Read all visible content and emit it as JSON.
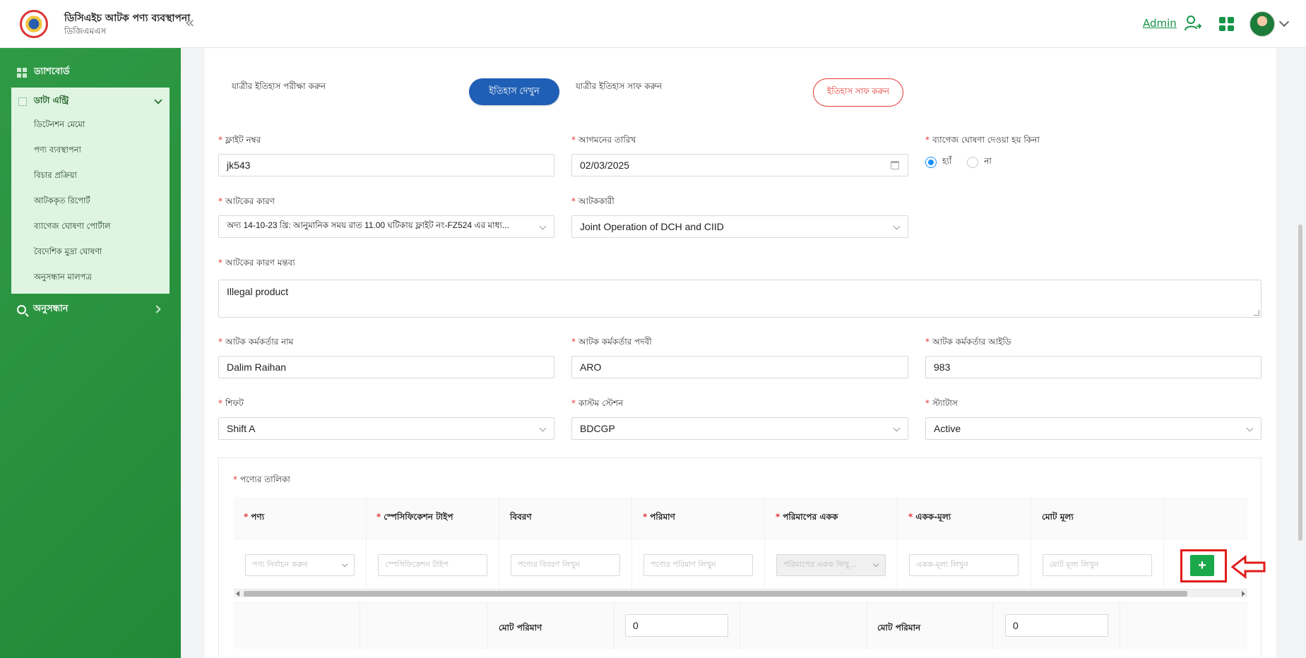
{
  "header": {
    "app_title": "ডিসিএইচ আটক পণ্য ব্যবস্থাপনা",
    "app_subtitle": "ডিজিএমএস",
    "user_label": "Admin"
  },
  "sidebar": {
    "dashboard": "ড্যাশবোর্ড",
    "data_entry": "ডাটা এন্ট্রি",
    "items": [
      "ডিটেনশন মেমো",
      "পণ্য ব্যবস্থাপনা",
      "বিচার প্রক্রিয়া",
      "আটককৃত রিপোর্ট",
      "ব্যাগেজ ঘোষণা পোর্টাল",
      "বৈদেশিক মুদ্রা ঘোষণা",
      "অনুসন্ধান মালপত্র"
    ],
    "search": "অনুসন্ধান"
  },
  "history": {
    "check_label": "যাত্রীর ইতিহাস পরীক্ষা করুন",
    "view_button": "ইতিহাস দেখুন",
    "clear_label": "যাত্রীর ইতিহাস সাফ করুন",
    "clear_button": "ইতিহাস সাফ করুন"
  },
  "form": {
    "required_mark": "*",
    "flight_label": "ফ্লাইট নম্বর",
    "flight_value": "jk543",
    "arrival_label": "আগমনের তারিখ",
    "arrival_value": "02/03/2025",
    "baggage_label": "ব্যাগেজ ঘোষণা দেওয়া হয় কিনা",
    "baggage_yes": "হ্যাঁ",
    "baggage_no": "না",
    "reason_label": "আটকের কারণ",
    "reason_value": "অদ্য 14-10-23 খ্রি: আনুমানিক সময় রাত 11.00 ঘটিকায় ফ্লাইট নং-FZ524 এর মাধ্য...",
    "seizer_label": "আটককারী",
    "seizer_value": "Joint Operation of DCH and CIID",
    "remark_label": "আটকের কারণ মন্তব্য",
    "remark_value": "Illegal product",
    "officer_name_label": "আটক কর্মকর্তার নাম",
    "officer_name_value": "Dalim Raihan",
    "officer_desig_label": "আটক কর্মকর্তার পদবী",
    "officer_desig_value": "ARO",
    "officer_id_label": "আটক কর্মকর্তার আইডি",
    "officer_id_value": "983",
    "shift_label": "শিফট",
    "shift_value": "Shift A",
    "station_label": "কাস্টম স্টেশন",
    "station_value": "BDCGP",
    "status_label": "স্ট্যাটাস",
    "status_value": "Active"
  },
  "goods": {
    "title": "পণ্যের তালিকা",
    "columns": [
      "পণ্য",
      "স্পেসিফিকেশন টাইপ",
      "বিবরণ",
      "পরিমাণ",
      "পরিমাপের একক",
      "একক-মূল্য",
      "মোট মূল্য"
    ],
    "placeholders": [
      "পণ্য নির্বাচন করুন",
      "স্পেসিফিকেশন টাইপ",
      "পণ্যের বিবরণ লিখুন",
      "পণ্যের পরিমাণ লিখুন",
      "পরিমাপের একক লিখু...",
      "একক-মূল্য লিখুন",
      "মোট মূল্য লিখুন"
    ],
    "add_symbol": "+",
    "total_qty_label": "মোট পরিমাণ",
    "total_qty_value": "0",
    "total_amount_label": "মোট পরিমান",
    "total_amount_value": "0"
  },
  "colors": {
    "brand_green": "#159447",
    "primary_blue": "#1f5fb6",
    "danger_red": "#e53935",
    "annotation_red": "#e31b1b"
  }
}
